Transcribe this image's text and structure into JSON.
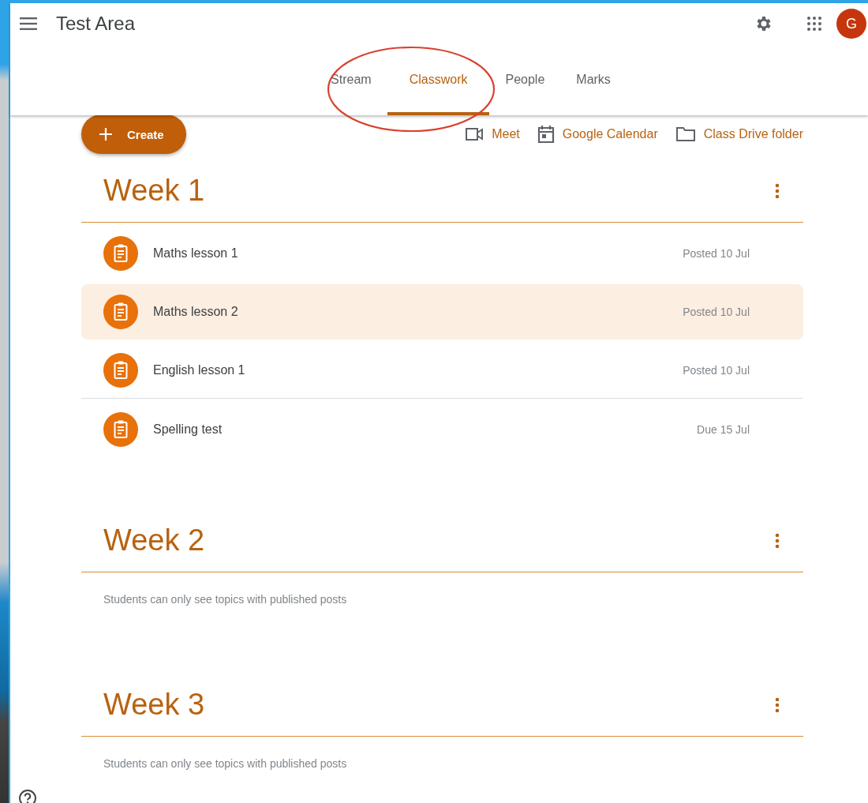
{
  "app_bar": {
    "title": "Test Area",
    "avatar_letter": "G"
  },
  "tabs": [
    {
      "label": "Stream",
      "selected": false
    },
    {
      "label": "Classwork",
      "selected": true
    },
    {
      "label": "People",
      "selected": false
    },
    {
      "label": "Marks",
      "selected": false
    }
  ],
  "create_button": {
    "label": "Create"
  },
  "links": [
    {
      "kind": "video",
      "label": "Meet"
    },
    {
      "kind": "calendar",
      "label": "Google Calendar"
    },
    {
      "kind": "folder",
      "label": "Class Drive folder"
    }
  ],
  "topics": [
    {
      "title": "Week 1",
      "items": [
        {
          "title": "Maths lesson 1",
          "meta": "Posted 10 Jul",
          "selected": false,
          "separator_below": false
        },
        {
          "title": "Maths lesson 2",
          "meta": "Posted 10 Jul",
          "selected": true,
          "separator_below": false
        },
        {
          "title": "English lesson 1",
          "meta": "Posted 10 Jul",
          "selected": false,
          "separator_below": true
        },
        {
          "title": "Spelling test",
          "meta": "Due 15 Jul",
          "selected": false,
          "separator_below": false
        }
      ]
    },
    {
      "title": "Week 2",
      "note": "Students can only see topics with published posts"
    },
    {
      "title": "Week 3",
      "note": "Students can only see topics with published posts"
    }
  ]
}
